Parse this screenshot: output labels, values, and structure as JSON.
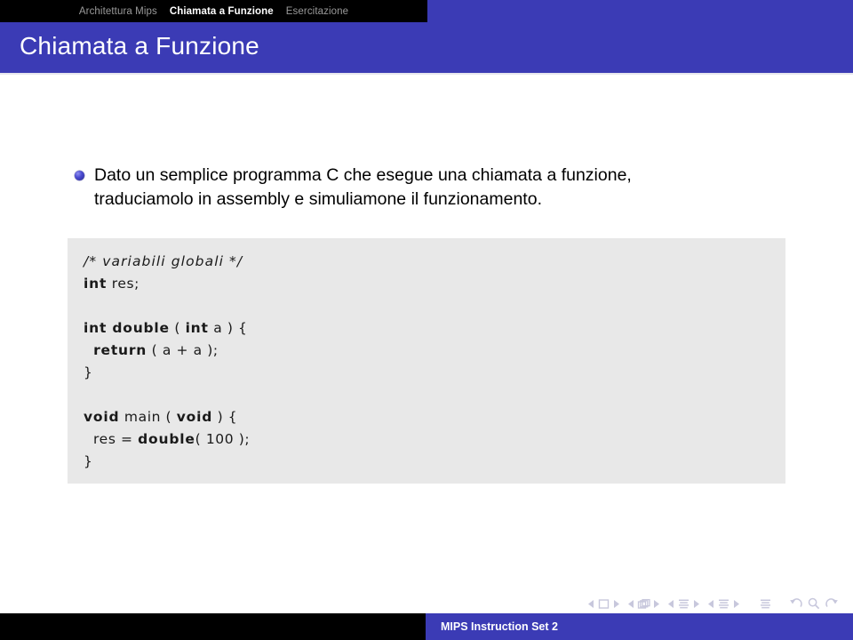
{
  "navbar": {
    "items": [
      {
        "label": "Architettura Mips",
        "active": false
      },
      {
        "label": "Chiamata a Funzione",
        "active": true
      },
      {
        "label": "Esercitazione",
        "active": false
      }
    ],
    "accent_color": "#3b3bb5",
    "bar_color": "#000000"
  },
  "slide": {
    "title": "Chiamata a Funzione"
  },
  "bullets": [
    {
      "marker": "ball-bullet-icon",
      "text": "Dato un semplice programma C che esegue una chiamata a funzione, traduciamolo in assembly e simuliamone il funzionamento."
    }
  ],
  "code_block": {
    "language": "C",
    "background_color": "#e8e8e8",
    "lines": [
      {
        "segments": [
          {
            "text": "/* variabili globali */",
            "style": "comment"
          }
        ]
      },
      {
        "segments": [
          {
            "text": "int",
            "style": "keyword"
          },
          {
            "text": " res;",
            "style": "plain"
          }
        ]
      },
      {
        "segments": []
      },
      {
        "segments": [
          {
            "text": "int double",
            "style": "keyword"
          },
          {
            "text": " ( ",
            "style": "plain"
          },
          {
            "text": "int",
            "style": "keyword"
          },
          {
            "text": " a ) {",
            "style": "plain"
          }
        ]
      },
      {
        "segments": [
          {
            "text": "  ",
            "style": "plain"
          },
          {
            "text": "return",
            "style": "keyword"
          },
          {
            "text": " ( a + a );",
            "style": "plain"
          }
        ]
      },
      {
        "segments": [
          {
            "text": "}",
            "style": "plain"
          }
        ]
      },
      {
        "segments": []
      },
      {
        "segments": [
          {
            "text": "void",
            "style": "keyword"
          },
          {
            "text": " main ( ",
            "style": "plain"
          },
          {
            "text": "void",
            "style": "keyword"
          },
          {
            "text": " ) {",
            "style": "plain"
          }
        ]
      },
      {
        "segments": [
          {
            "text": "  res = ",
            "style": "plain"
          },
          {
            "text": "double",
            "style": "keyword"
          },
          {
            "text": "( 100 );",
            "style": "plain"
          }
        ]
      },
      {
        "segments": [
          {
            "text": "}",
            "style": "plain"
          }
        ]
      }
    ]
  },
  "nav_symbols": {
    "groups": [
      {
        "prev": "prev-slide-icon",
        "glyph": "slide-icon",
        "next": "next-slide-icon"
      },
      {
        "prev": "prev-frame-icon",
        "glyph": "frame-icon",
        "next": "next-frame-icon"
      },
      {
        "prev": "prev-subsection-icon",
        "glyph": "subsection-icon",
        "next": "next-subsection-icon"
      },
      {
        "prev": "prev-section-icon",
        "glyph": "section-icon",
        "next": "next-section-icon"
      }
    ],
    "extra": [
      {
        "name": "toc-icon"
      },
      {
        "name": "back-icon"
      },
      {
        "name": "search-icon"
      },
      {
        "name": "forward-icon"
      }
    ]
  },
  "footer": {
    "text": "MIPS Instruction Set 2"
  }
}
